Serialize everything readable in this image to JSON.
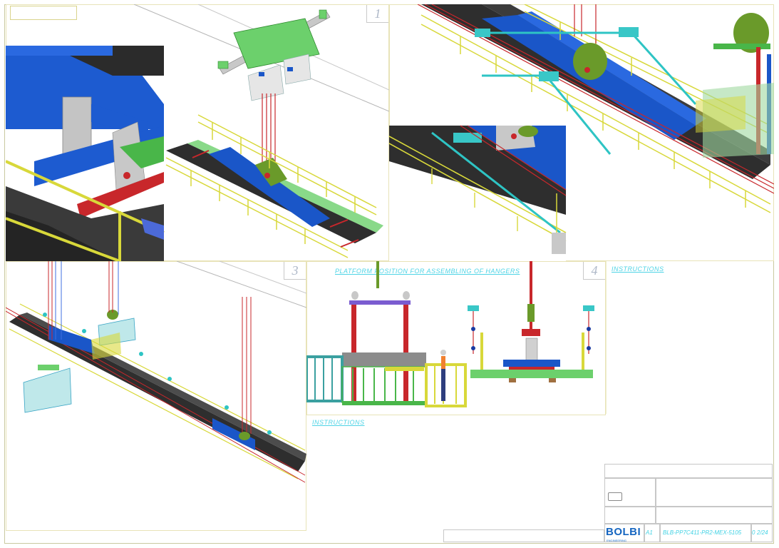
{
  "panels": {
    "p1": "1",
    "p3": "3",
    "p4": "4"
  },
  "captions": {
    "platform_title": "PLATFORM POSITION FOR ASSEMBLING OF HANGERS",
    "instructions_right": "INSTRUCTIONS",
    "instructions_bottom": "INSTRUCTIONS"
  },
  "title_block": {
    "logo": "BOLBI",
    "logo_sub": "ENGINEERING",
    "sheet_size": "A1",
    "doc_number": "BLB-PP7C411-PR2-MEX-5105",
    "revision": "0",
    "sheet": "2/24"
  },
  "colors": {
    "blue_beam": "#1a56c8",
    "green_frame": "#5cc45c",
    "yellow_rail": "#d8d83a",
    "red_rod": "#c8272b",
    "cyan_strut": "#2ec4c4",
    "dark_deck": "#2e2e2e",
    "olive_plate": "#6a9a2a"
  }
}
